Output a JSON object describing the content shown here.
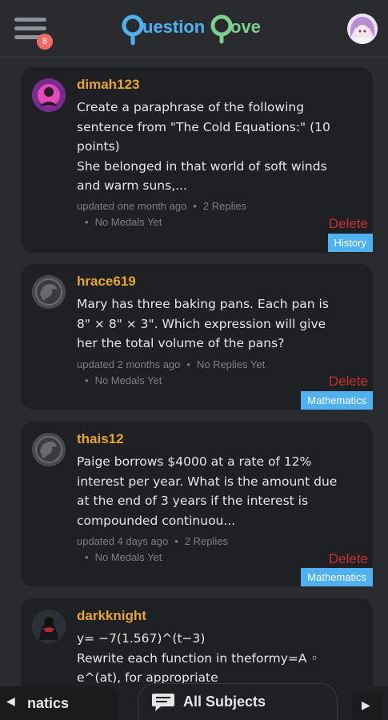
{
  "header": {
    "logo_text": "QuestionCove",
    "notification_count": "8",
    "colors": {
      "logo_blue": "#4fb1ef",
      "logo_green": "#7ccf8f"
    }
  },
  "posts": [
    {
      "username": "dimah123",
      "question": "Create a paraphrase of the following sentence from \"The Cold Equations:\" (10 points)\nShe belonged in that world of soft winds and warm suns,...",
      "updated": "updated one month ago",
      "replies": "2 Replies",
      "medals": "No Medals Yet",
      "delete_label": "Delete",
      "subject": "History",
      "avatar_icon": "user-photo"
    },
    {
      "username": "hrace619",
      "question": "Mary has three baking pans. Each pan is 8\" × 8\" × 3\". Which expression will give her the total volume of the pans?",
      "updated": "updated 2 months ago",
      "replies": "No Replies Yet",
      "medals": "No Medals Yet",
      "delete_label": "Delete",
      "subject": "Mathematics",
      "avatar_icon": "default-avatar-icon"
    },
    {
      "username": "thais12",
      "question": "Paige borrows $4000 at a rate of 12% interest per year. What is the amount due at the end of 3 years if the interest is compounded continuou...",
      "updated": "updated 4 days ago",
      "replies": "2 Replies",
      "medals": "No Medals Yet",
      "delete_label": "Delete",
      "subject": "Mathematics",
      "avatar_icon": "default-avatar-icon"
    },
    {
      "username": "darkknight",
      "question": "y= −7(1.567)^(t−3)\nRewrite each function in theformy=A ◦ e^(at), for appropriate",
      "avatar_icon": "user-photo"
    }
  ],
  "bottom_nav": {
    "prev_label": "natics",
    "all_label": "All Subjects"
  }
}
